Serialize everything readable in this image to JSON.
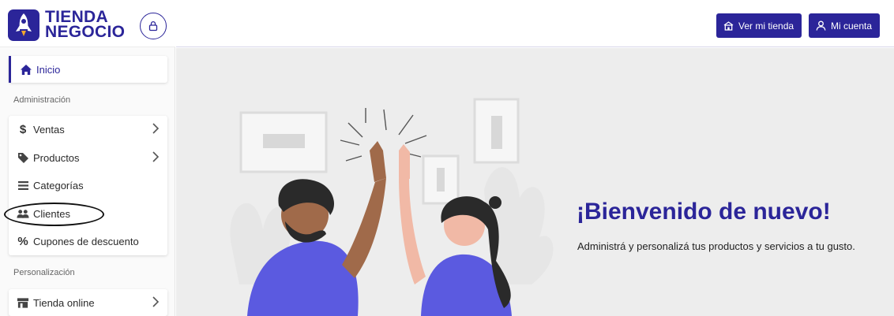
{
  "brand": {
    "line1": "TIENDA",
    "line2": "NEGOCIO",
    "color": "#2b2599"
  },
  "header": {
    "store_button": {
      "label": "Ver mi tienda",
      "icon": "storefront-icon"
    },
    "account_button": {
      "label": "Mi cuenta",
      "icon": "user-icon"
    }
  },
  "sidebar": {
    "home": {
      "label": "Inicio",
      "icon": "home-icon"
    },
    "section_admin": "Administración",
    "admin_items": [
      {
        "label": "Ventas",
        "icon": "dollar-icon",
        "has_submenu": true
      },
      {
        "label": "Productos",
        "icon": "tag-icon",
        "has_submenu": true
      },
      {
        "label": "Categorías",
        "icon": "list-icon",
        "has_submenu": false
      },
      {
        "label": "Clientes",
        "icon": "users-icon",
        "has_submenu": false
      },
      {
        "label": "Cupones de descuento",
        "icon": "percent-icon",
        "has_submenu": false
      }
    ],
    "section_custom": "Personalización",
    "custom_items": [
      {
        "label": "Tienda online",
        "icon": "store-icon",
        "has_submenu": true
      }
    ]
  },
  "main": {
    "title": "¡Bienvenido de nuevo!",
    "subtitle": "Administrá y personalizá tus productos y servicios a tu gusto."
  }
}
